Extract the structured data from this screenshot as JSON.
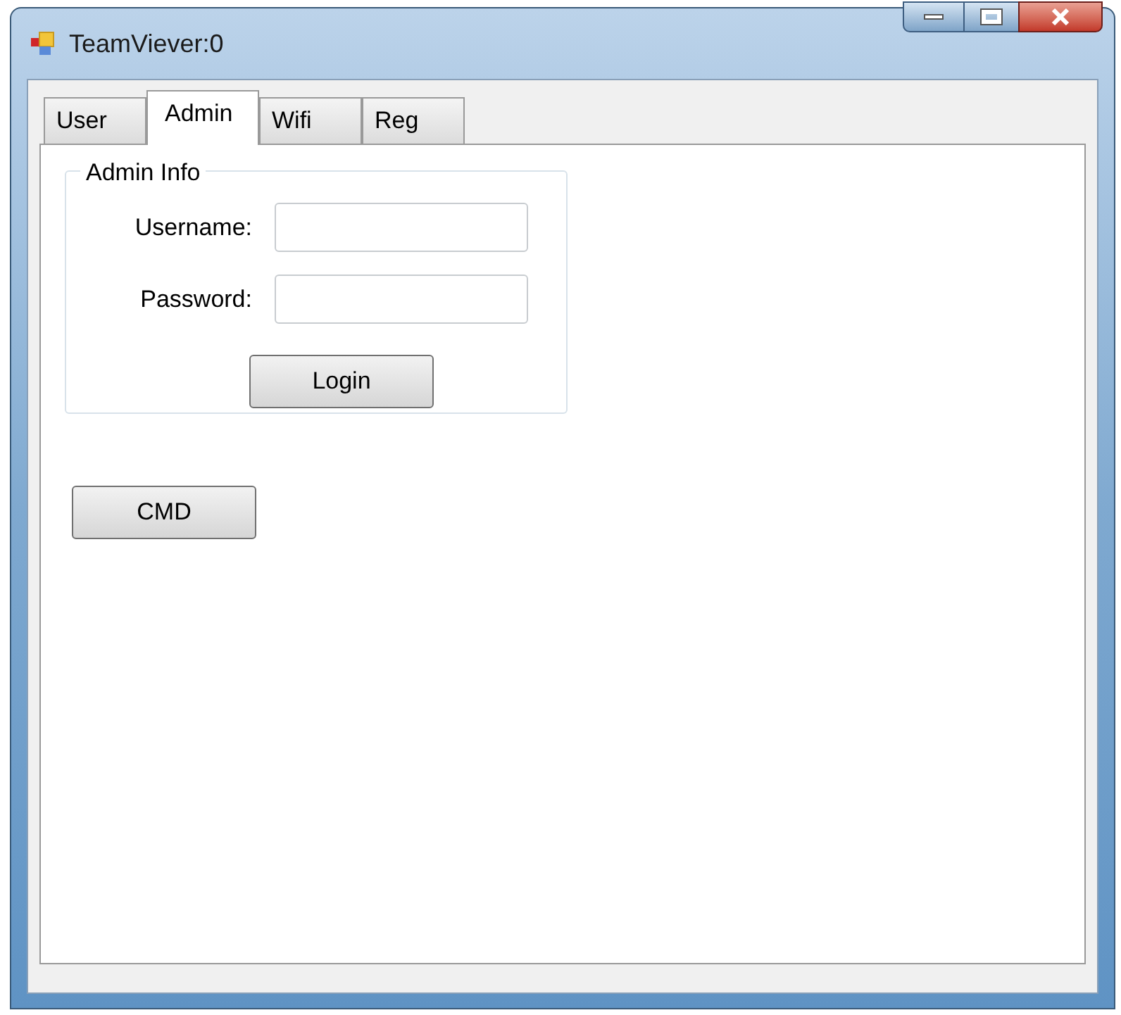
{
  "window": {
    "title": "TeamViever:0"
  },
  "tabs": [
    {
      "label": "User",
      "selected": false
    },
    {
      "label": "Admin",
      "selected": true
    },
    {
      "label": "Wifi",
      "selected": false
    },
    {
      "label": "Reg",
      "selected": false
    }
  ],
  "group": {
    "title": "Admin Info",
    "fields": [
      {
        "label": "Username:"
      },
      {
        "label": "Password:"
      }
    ],
    "button": "Login"
  },
  "buttons": [
    "CMD"
  ]
}
